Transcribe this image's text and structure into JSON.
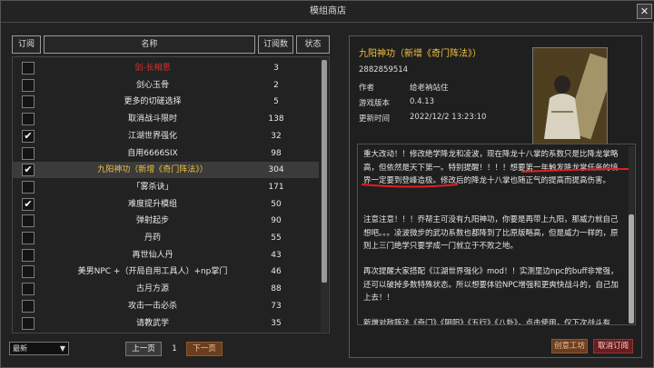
{
  "window": {
    "title": "模组商店",
    "close_label": "✕"
  },
  "columns": {
    "subscribe": "订阅",
    "name": "名称",
    "count": "订阅数",
    "status": "状态"
  },
  "rows": [
    {
      "name": "剑-长相思",
      "count": "3",
      "checked": false,
      "color": "#e03030"
    },
    {
      "name": "剑心玉骨",
      "count": "2",
      "checked": false,
      "color": "#e8e8e8"
    },
    {
      "name": "更多的切磋选择",
      "count": "5",
      "checked": false,
      "color": "#e8e8e8"
    },
    {
      "name": "取消战斗限时",
      "count": "138",
      "checked": false,
      "color": "#e8e8e8"
    },
    {
      "name": "江湖世界强化",
      "count": "32",
      "checked": true,
      "color": "#e8e8e8"
    },
    {
      "name": "自用6666SIX",
      "count": "98",
      "checked": false,
      "color": "#e8e8e8"
    },
    {
      "name": "九阳神功（新增《奇门阵法》）",
      "count": "304",
      "checked": true,
      "color": "#f0c040",
      "selected": true
    },
    {
      "name": "「雾杀诀」",
      "count": "171",
      "checked": false,
      "color": "#e8e8e8"
    },
    {
      "name": "难度提升模组",
      "count": "50",
      "checked": true,
      "color": "#e8e8e8"
    },
    {
      "name": "弹射起步",
      "count": "90",
      "checked": false,
      "color": "#e8e8e8"
    },
    {
      "name": "丹药",
      "count": "55",
      "checked": false,
      "color": "#e8e8e8"
    },
    {
      "name": "再世仙人丹",
      "count": "43",
      "checked": false,
      "color": "#e8e8e8"
    },
    {
      "name": "美男NPC +（开局自用工具人）+np掌门",
      "count": "46",
      "checked": false,
      "color": "#e8e8e8"
    },
    {
      "name": "古月方源",
      "count": "88",
      "checked": false,
      "color": "#e8e8e8"
    },
    {
      "name": "攻击一击必杀",
      "count": "73",
      "checked": false,
      "color": "#e8e8e8"
    },
    {
      "name": "请教武学",
      "count": "35",
      "checked": false,
      "color": "#e8e8e8"
    }
  ],
  "bottom": {
    "sort": "最新",
    "prev": "上一页",
    "page": "1",
    "next": "下一页"
  },
  "detail": {
    "title": "九阳神功（新增《奇门阵法》）",
    "id": "2882859514",
    "author_label": "作者",
    "author": "给老衲站住",
    "version_label": "游戏版本",
    "version": "0.4.13",
    "updated_label": "更新时间",
    "updated": "2022/12/2 13:23:10",
    "desc": [
      "重大改动！！修改绝学降龙和凌波，现在降龙十八掌的系数只是比降龙掌略高，但依然是天下第一。特别提醒！！！！想要第一年触发降龙掌任务的境界一定要到登峰造极。修改后的降龙十八掌也随正气的提高而提高伤害。",
      "注意注意！！！乔帮主可没有九阳神功，你要是再带上九阳，那威力就自己想吧。。。凌波微步的武功系数也都降到了比原版略高，但是威力一样的，原则上三门绝学只要学成一门就立于不败之地。",
      "再次提醒大家搭配《江湖世界强化》mod！！实测里边npc的buff非常强，还可以破掉多数特殊状态。所以想要体验NPC增强和更爽快战斗的，自己加上去！！",
      "新增对敌阵法《奇门》《阴阳》《五行》《八卦》，点击使用，仅下次战斗有效，同时关闭下次战斗的时限，战斗后阵型和时限恢复默认。每次战斗只能生效一种，战法十分可观来参考。"
    ],
    "subscribe_btn": "创意工坊",
    "unsubscribe_btn": "取消订阅"
  }
}
